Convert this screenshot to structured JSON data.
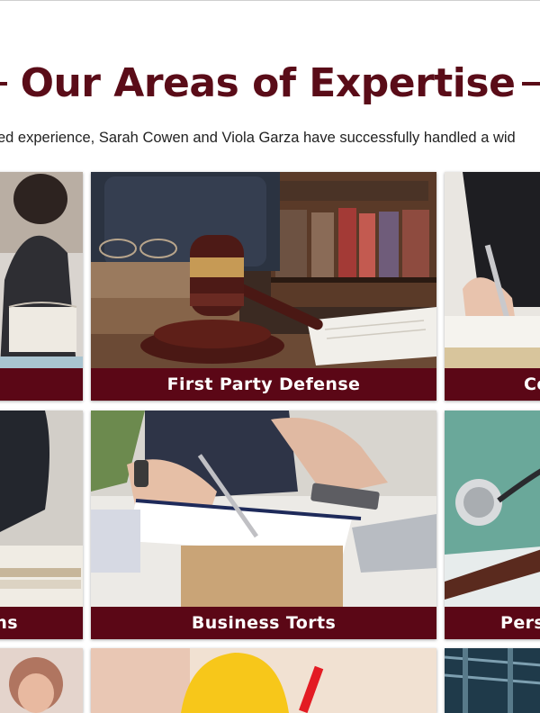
{
  "section": {
    "title": "Our Areas of Expertise",
    "intro": "ed experience, Sarah Cowen and Viola Garza have successfully handled a wid"
  },
  "practice_areas": [
    {
      "label": ""
    },
    {
      "label": "First Party Defense"
    },
    {
      "label": "Co"
    },
    {
      "label": "ns"
    },
    {
      "label": "Business Torts"
    },
    {
      "label": "Pers"
    }
  ],
  "colors": {
    "brand_maroon": "#5a0c18",
    "label_background": "#5b0716",
    "label_text": "#ffffff",
    "body_text": "#222222"
  }
}
